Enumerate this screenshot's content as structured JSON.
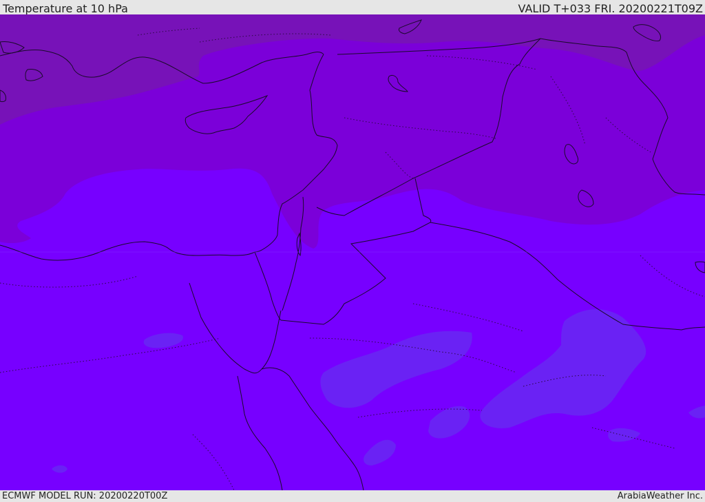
{
  "header": {
    "title": "Temperature at 10 hPa",
    "valid": "VALID T+033 FRI. 20200221T09Z"
  },
  "footer": {
    "model_run": "ECMWF MODEL RUN: 20200220T00Z",
    "brand": "ArabiaWeather Inc."
  },
  "colors": {
    "band_coldest": "#7712b8",
    "band_cold": "#7b00d9",
    "band_base": "#7700ff",
    "band_warm": "#6a22f4",
    "coastline": "#1a0a2a",
    "border": "#1a0a2a",
    "chrome": "#e6e6e6"
  }
}
